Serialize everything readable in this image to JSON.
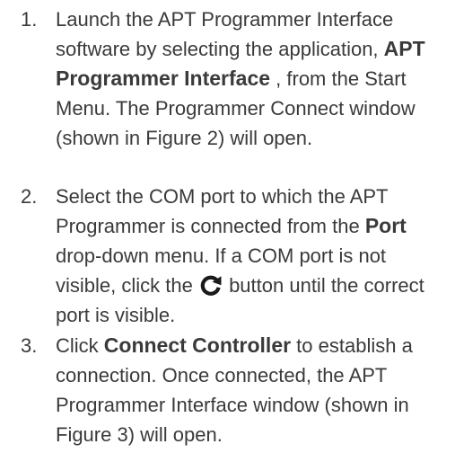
{
  "steps": [
    {
      "number": "1.",
      "parts": {
        "a": "Launch the APT Programmer Interface software by selecting the application, ",
        "b": "APT Programmer Interface",
        "c": " , from the Start Menu. The Programmer Connect window (shown in Figure 2) will open."
      }
    },
    {
      "number": "2.",
      "parts": {
        "a": "Select the COM port to which the APT Programmer is connected from the ",
        "b": "Port",
        "c": " drop-down menu. If a COM port is not visible, click the ",
        "d": " button until the correct port is visible."
      },
      "icon": "refresh-icon"
    },
    {
      "number": "3.",
      "parts": {
        "a": "Click ",
        "b": "Connect Controller",
        "c": " to establish a connection. Once connected, the APT Programmer Interface window (shown in Figure 3) will open."
      }
    }
  ],
  "colors": {
    "text": "#3a3a3a",
    "bold": "#333333",
    "icon": "#1a1a1a"
  }
}
